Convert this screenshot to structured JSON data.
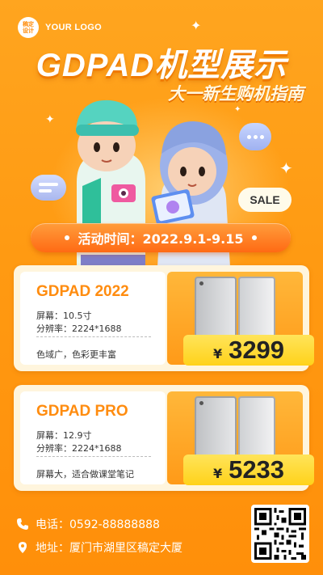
{
  "logo": {
    "badge": "稿定\n设计",
    "text": "YOUR LOGO"
  },
  "title": "GDPAD机型展示",
  "subtitle": "大一新生购机指南",
  "sale_label": "SALE",
  "event": {
    "label": "活动时间：2022.9.1-9.15"
  },
  "products": [
    {
      "name": "GDPAD 2022",
      "screen": "屏幕：10.5寸",
      "resolution": "分辨率：2224*1688",
      "feature": "色域广，色彩更丰富",
      "currency": "¥",
      "price": "3299"
    },
    {
      "name": "GDPAD PRO",
      "screen": "屏幕：12.9寸",
      "resolution": "分辨率：2224*1688",
      "feature": "屏幕大，适合做课堂笔记",
      "currency": "¥",
      "price": "5233"
    }
  ],
  "contact": {
    "phone": "电话：0592-88888888",
    "address": "地址：厦门市湖里区稿定大厦"
  },
  "colors": {
    "accent": "#ff8c0f",
    "price_bg": "#ffd21a",
    "background": "#ffa51f"
  }
}
